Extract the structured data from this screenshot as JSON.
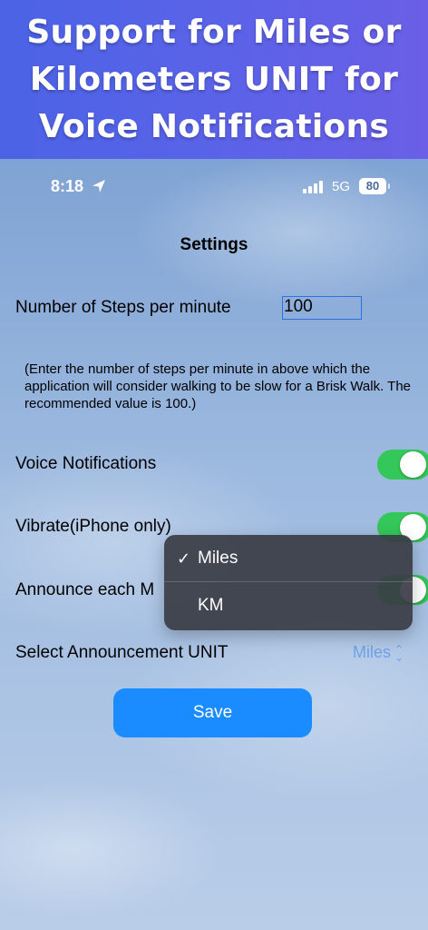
{
  "banner": {
    "title": "Support for Miles or Kilometers UNIT for Voice Notifications"
  },
  "status_bar": {
    "time": "8:18",
    "network": "5G",
    "battery": "80"
  },
  "settings": {
    "title": "Settings",
    "steps_label": "Number of Steps per minute",
    "steps_value": "100",
    "hint": "(Enter the number of steps per minute in above which the application will consider walking to be slow for a Brisk Walk. The recommended value is 100.)",
    "voice_label": "Voice Notifications",
    "vibrate_label": "Vibrate(iPhone only)",
    "announce_label": "Announce each M",
    "unit_label": "Select Announcement UNIT",
    "unit_value": "Miles",
    "save_label": "Save",
    "toggles": {
      "voice": true,
      "vibrate": true,
      "announce": true
    }
  },
  "menu": {
    "items": [
      {
        "label": "Miles",
        "checked": true
      },
      {
        "label": "KM",
        "checked": false
      }
    ],
    "check_glyph": "✓"
  },
  "colors": {
    "accent": "#1a8cff",
    "toggle_on": "#34c759",
    "banner": "#5a63e8"
  }
}
